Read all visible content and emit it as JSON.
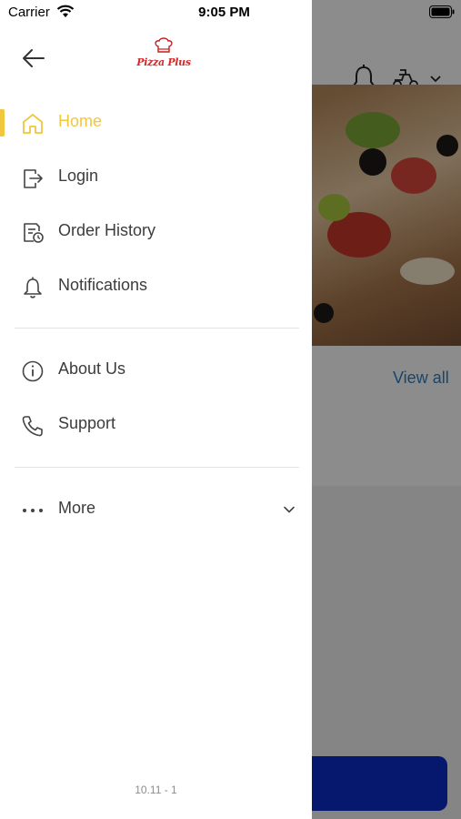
{
  "status_bar": {
    "carrier": "Carrier",
    "time": "9:05 PM"
  },
  "drawer": {
    "logo_text": "Pizza Plus",
    "menu_primary": [
      {
        "label": "Home",
        "icon": "home-icon",
        "active": true
      },
      {
        "label": "Login",
        "icon": "login-icon",
        "active": false
      },
      {
        "label": "Order History",
        "icon": "order-history-icon",
        "active": false
      },
      {
        "label": "Notifications",
        "icon": "bell-icon",
        "active": false
      }
    ],
    "menu_secondary": [
      {
        "label": "About Us",
        "icon": "info-icon"
      },
      {
        "label": "Support",
        "icon": "phone-icon"
      }
    ],
    "more_label": "More",
    "version": "10.11 - 1"
  },
  "background": {
    "view_all": "View all"
  },
  "colors": {
    "accent": "#f0c73d",
    "text": "#3c3c3c",
    "link": "#2d7fc0",
    "primary_button": "#0a2cc8"
  }
}
